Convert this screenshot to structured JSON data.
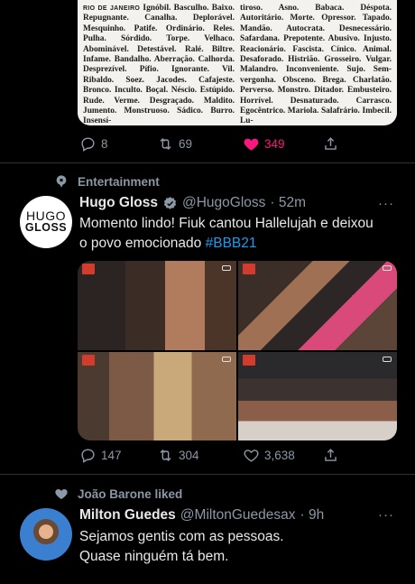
{
  "tweet1": {
    "newspaper_columns": [
      {
        "lead": "RIO DE JANEIRO",
        "text": "Ignóbil. Basculho. Baixo. Repugnante. Canalha. Deplorável. Mesquinho. Patife. Ordinário. Reles. Pulha. Sórdido. Torpe. Velhaco. Abominável. Detestável. Ralé. Biltre. Infame. Bandalho. Aberração. Calhorda. Desprezível. Pífio. Ignorante. Vil. Ribaldo. Soez. Jacodes. Cafajeste. Bronco. Inculto. Boçal. Néscio. Estúpido. Rude. Verme. Desgraçado. Maldito. Jumento. Monstruoso. Sádico. Burro. Insensí-"
      },
      {
        "lead": "",
        "text": "tiroso. Asno. Babaca. Déspota. Autoritário. Morte. Opressor. Tapado. Mandão. Autocrata. Desnecessário. Safardana. Prepotente. Abusivo. Injusto. Reacionário. Fascista. Cínico. Animal. Desaforado. Histrião. Grosseiro. Vulgar. Malandro. Inconveniente. Sujo. Sem-vergonha. Obsceno. Brega. Charlatão. Perverso. Monstro. Ditador. Embusteiro. Horrível. Desnaturado. Carrasco. Egocêntrico. Mariola. Salafrário. Imbecil. Lu-"
      }
    ],
    "replies": "8",
    "retweets": "69",
    "likes": "349"
  },
  "tweet2": {
    "context": "Entertainment",
    "avatar_text_line1": "HUGO",
    "avatar_text_line2": "GLOSS",
    "name": "Hugo Gloss",
    "handle": "@HugoGloss",
    "time": "· 52m",
    "more": "···",
    "text": "Momento lindo! Fiuk cantou Hallelujah e deixou o povo emocionado ",
    "hashtag": "#BBB21",
    "replies": "147",
    "retweets": "304",
    "likes": "3,638"
  },
  "tweet3": {
    "context": "João Barone liked",
    "name": "Milton Guedes",
    "handle": "@MiltonGuedesax",
    "time": "· 9h",
    "more": "···",
    "text_line1": "Sejamos gentis com as pessoas.",
    "text_line2": "Quase ninguém tá bem."
  },
  "colors": {
    "background": "#000000",
    "text": "#e7e9ea",
    "secondary": "#8b98a5",
    "like": "#f91880",
    "link": "#1d9bf0",
    "divider": "#2f3336"
  }
}
